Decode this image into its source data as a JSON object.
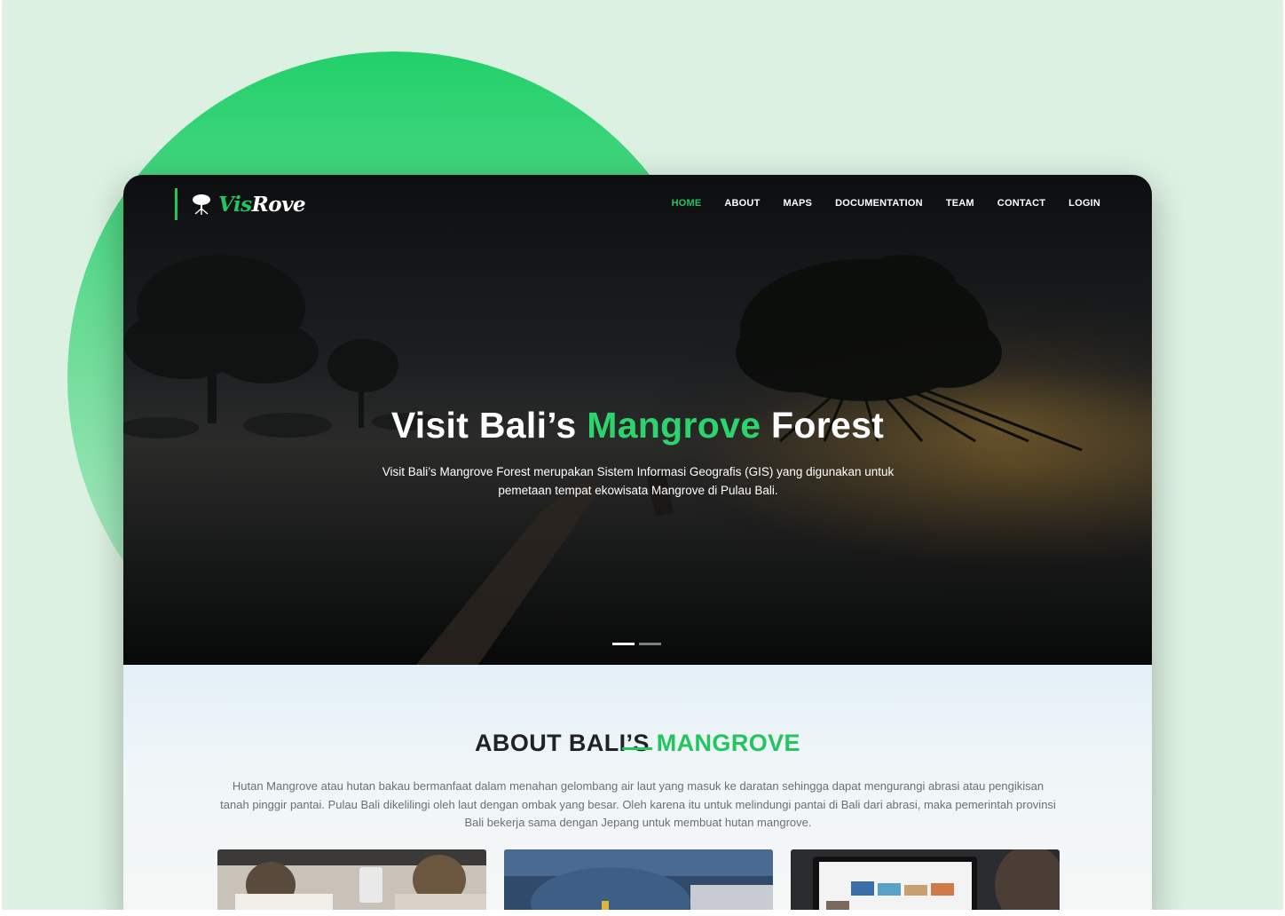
{
  "brand": {
    "logo_text_prefix": "Vis",
    "logo_text_suffix": "Rove",
    "accent_color": "#22c55e",
    "icon": "mangrove-tree-icon"
  },
  "nav": {
    "items": [
      {
        "label": "HOME",
        "active": true
      },
      {
        "label": "ABOUT",
        "active": false
      },
      {
        "label": "MAPS",
        "active": false
      },
      {
        "label": "DOCUMENTATION",
        "active": false
      },
      {
        "label": "TEAM",
        "active": false
      },
      {
        "label": "CONTACT",
        "active": false
      },
      {
        "label": "LOGIN",
        "active": false
      }
    ]
  },
  "hero": {
    "title_part1": "Visit Bali’s ",
    "title_highlight": "Mangrove",
    "title_part2": " Forest",
    "subtitle": "Visit Bali’s Mangrove Forest merupakan Sistem Informasi Geografis (GIS) yang digunakan untuk pemetaan tempat ekowisata Mangrove di Pulau Bali.",
    "slides_total": 2,
    "active_slide": 1
  },
  "about": {
    "title_part1": "ABOUT BALI’S ",
    "title_highlight": "MANGROVE",
    "text": "Hutan Mangrove atau hutan bakau bermanfaat dalam menahan gelombang air laut yang masuk ke daratan sehingga dapat mengurangi abrasi atau pengikisan tanah pinggir pantai. Pulau Bali dikelilingi oleh laut dengan ombak yang besar. Oleh karena itu untuk melindungi pantai di Bali dari abrasi, maka pemerintah provinsi Bali bekerja sama dengan Jepang untuk membuat hutan mangrove."
  }
}
